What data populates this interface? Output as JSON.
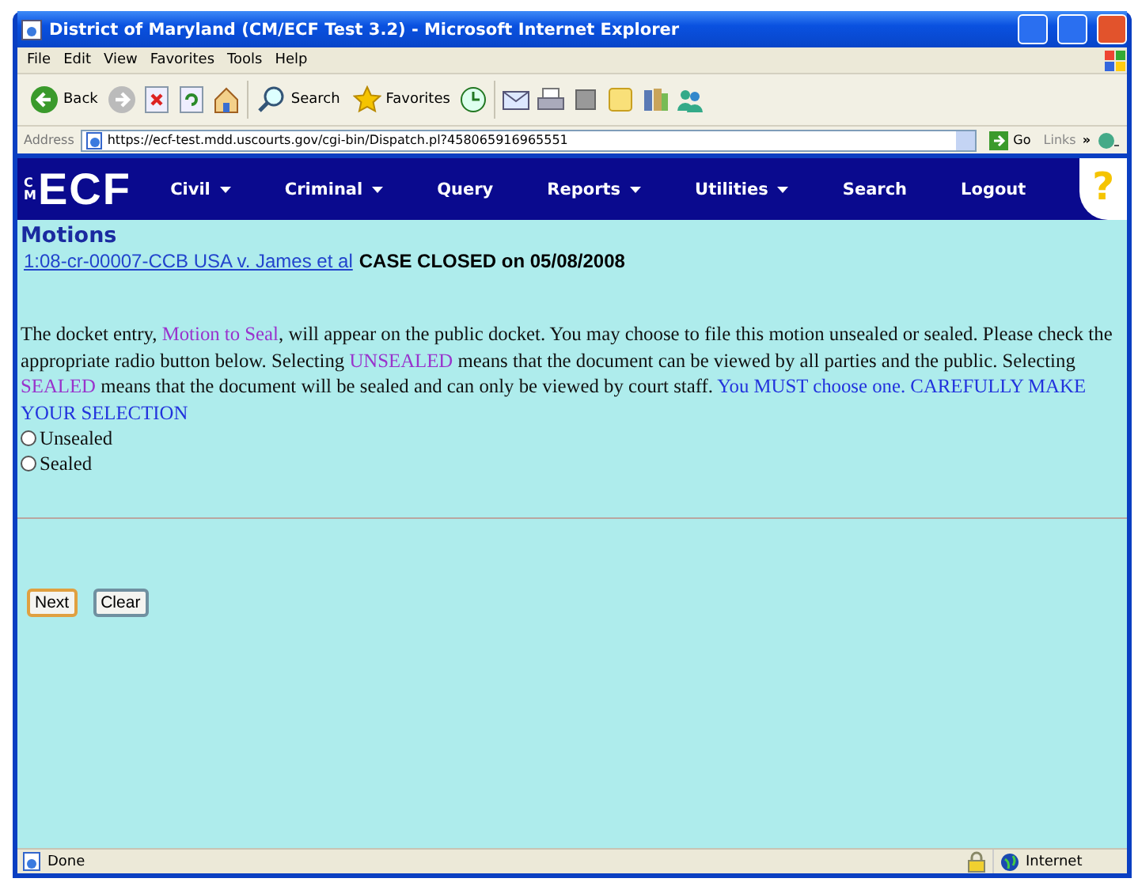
{
  "window": {
    "title": "District of Maryland (CM/ECF Test 3.2) - Microsoft Internet Explorer"
  },
  "menu_bar": [
    "File",
    "Edit",
    "View",
    "Favorites",
    "Tools",
    "Help"
  ],
  "toolbar": [
    {
      "kind": "back",
      "label": "Back"
    },
    {
      "kind": "forward"
    },
    {
      "kind": "stop"
    },
    {
      "kind": "refresh"
    },
    {
      "kind": "home"
    },
    {
      "kind": "search",
      "label": "Search"
    },
    {
      "kind": "favorites",
      "label": "Favorites"
    },
    {
      "kind": "history"
    },
    {
      "kind": "mail"
    },
    {
      "kind": "print"
    },
    {
      "kind": "edit"
    },
    {
      "kind": "note"
    },
    {
      "kind": "research"
    },
    {
      "kind": "messenger"
    }
  ],
  "address_bar": {
    "label": "Address",
    "value": "https://ecf-test.mdd.uscourts.gov/cgi-bin/Dispatch.pl?458065916965551",
    "go": "Go",
    "links": "Links",
    "more": "»"
  },
  "ecf_nav": {
    "logo_small": "CM",
    "logo": "ECF",
    "items": [
      {
        "label": "Civil",
        "dropdown": true
      },
      {
        "label": "Criminal",
        "dropdown": true
      },
      {
        "label": "Query",
        "dropdown": false
      },
      {
        "label": "Reports",
        "dropdown": true
      },
      {
        "label": "Utilities",
        "dropdown": true
      },
      {
        "label": "Search",
        "dropdown": false
      },
      {
        "label": "Logout",
        "dropdown": false
      }
    ],
    "help": "?"
  },
  "page": {
    "heading": "Motions",
    "case_link": "1:08-cr-00007-CCB USA v. James et al",
    "case_status": "CASE CLOSED on 05/08/2008",
    "paragraph": [
      {
        "kind": "plain",
        "text": "The docket entry, "
      },
      {
        "kind": "term",
        "text": "Motion to Seal"
      },
      {
        "kind": "plain",
        "text": ", will appear on the public docket. You may choose to file this motion unsealed or sealed. Please check the appropriate radio button below. Selecting "
      },
      {
        "kind": "term",
        "text": "UNSEALED"
      },
      {
        "kind": "plain",
        "text": " means that the document can be viewed by all parties and the public. Selecting "
      },
      {
        "kind": "term",
        "text": "SEALED"
      },
      {
        "kind": "plain",
        "text": " means that the document will be sealed and can only be viewed by court staff. "
      },
      {
        "kind": "warning",
        "text": "You MUST choose one. CAREFULLY MAKE YOUR SELECTION"
      }
    ],
    "options": [
      {
        "label": "Unsealed",
        "selected": false
      },
      {
        "label": "Sealed",
        "selected": false
      }
    ],
    "buttons": [
      {
        "label": "Next",
        "focused": true
      },
      {
        "label": "Clear",
        "focused": false
      }
    ]
  },
  "status_bar": {
    "text": "Done",
    "zone": "Internet",
    "secure": true
  }
}
